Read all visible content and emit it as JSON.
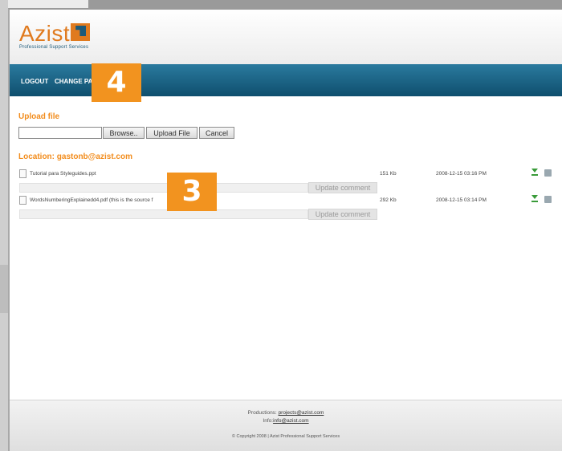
{
  "logo": {
    "name": "Azist",
    "tagline": "Professional Support Services"
  },
  "nav": {
    "logout": "LOGOUT",
    "change_password": "CHANGE PASS"
  },
  "badges": {
    "top": "4",
    "middle": "3"
  },
  "upload": {
    "title": "Upload file",
    "browse_label": "Browse..",
    "upload_label": "Upload File",
    "cancel_label": "Cancel"
  },
  "location": {
    "title": "Location: gastonb@azist.com"
  },
  "files": [
    {
      "name": "Tutorial para Styleguides.ppt",
      "size": "151 Kb",
      "date": "2008-12-15 03:16 PM",
      "update_label": "Update comment"
    },
    {
      "name": "WordsNumberingExplainedd4.pdf (this is the source f",
      "size": "292 Kb",
      "date": "2008-12-15 03:14 PM",
      "update_label": "Update comment"
    }
  ],
  "footer": {
    "productions_prefix": "Productions:",
    "productions_email": "projects@azist.com",
    "info_prefix": "Info:",
    "info_email": "info@azist.com",
    "copyright": "© Copyright 2008 | Azist Professional Support Services"
  },
  "colors": {
    "accent_orange": "#f28c1c",
    "nav_blue": "#0f4f6e",
    "badge_orange": "#f2931f"
  }
}
